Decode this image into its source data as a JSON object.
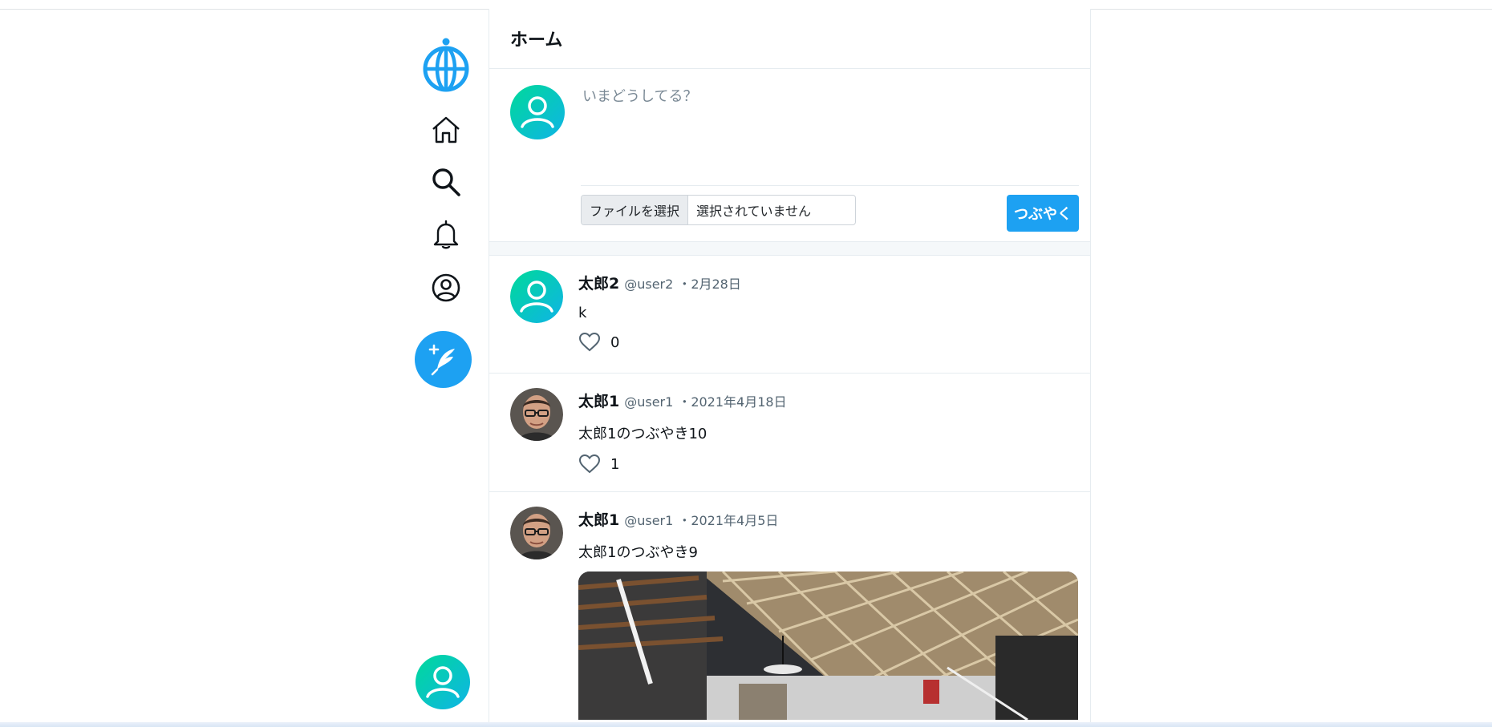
{
  "nav": {
    "logo_icon": "globe-icon",
    "items": [
      {
        "icon": "home-icon"
      },
      {
        "icon": "search-icon"
      },
      {
        "icon": "bell-icon"
      },
      {
        "icon": "user-circle-icon"
      }
    ],
    "compose_icon": "feather-plus-icon",
    "accent": "#1da1f2"
  },
  "header": {
    "title": "ホーム"
  },
  "composer": {
    "placeholder": "いまどうしてる？",
    "file_button_label": "ファイルを選択",
    "file_status": "選択されていません",
    "submit_label": "つぶやく"
  },
  "tweets": [
    {
      "name": "太郎2",
      "handle": "@user2",
      "date": "・2月28日",
      "text": "k",
      "likes": "0",
      "avatar": "default"
    },
    {
      "name": "太郎1",
      "handle": "@user1",
      "date": "・2021年4月18日",
      "text": "太郎1のつぶやき10",
      "likes": "1",
      "avatar": "photo"
    },
    {
      "name": "太郎1",
      "handle": "@user1",
      "date": "・2021年4月5日",
      "text": "太郎1のつぶやき9",
      "avatar": "photo",
      "has_image": true
    }
  ]
}
